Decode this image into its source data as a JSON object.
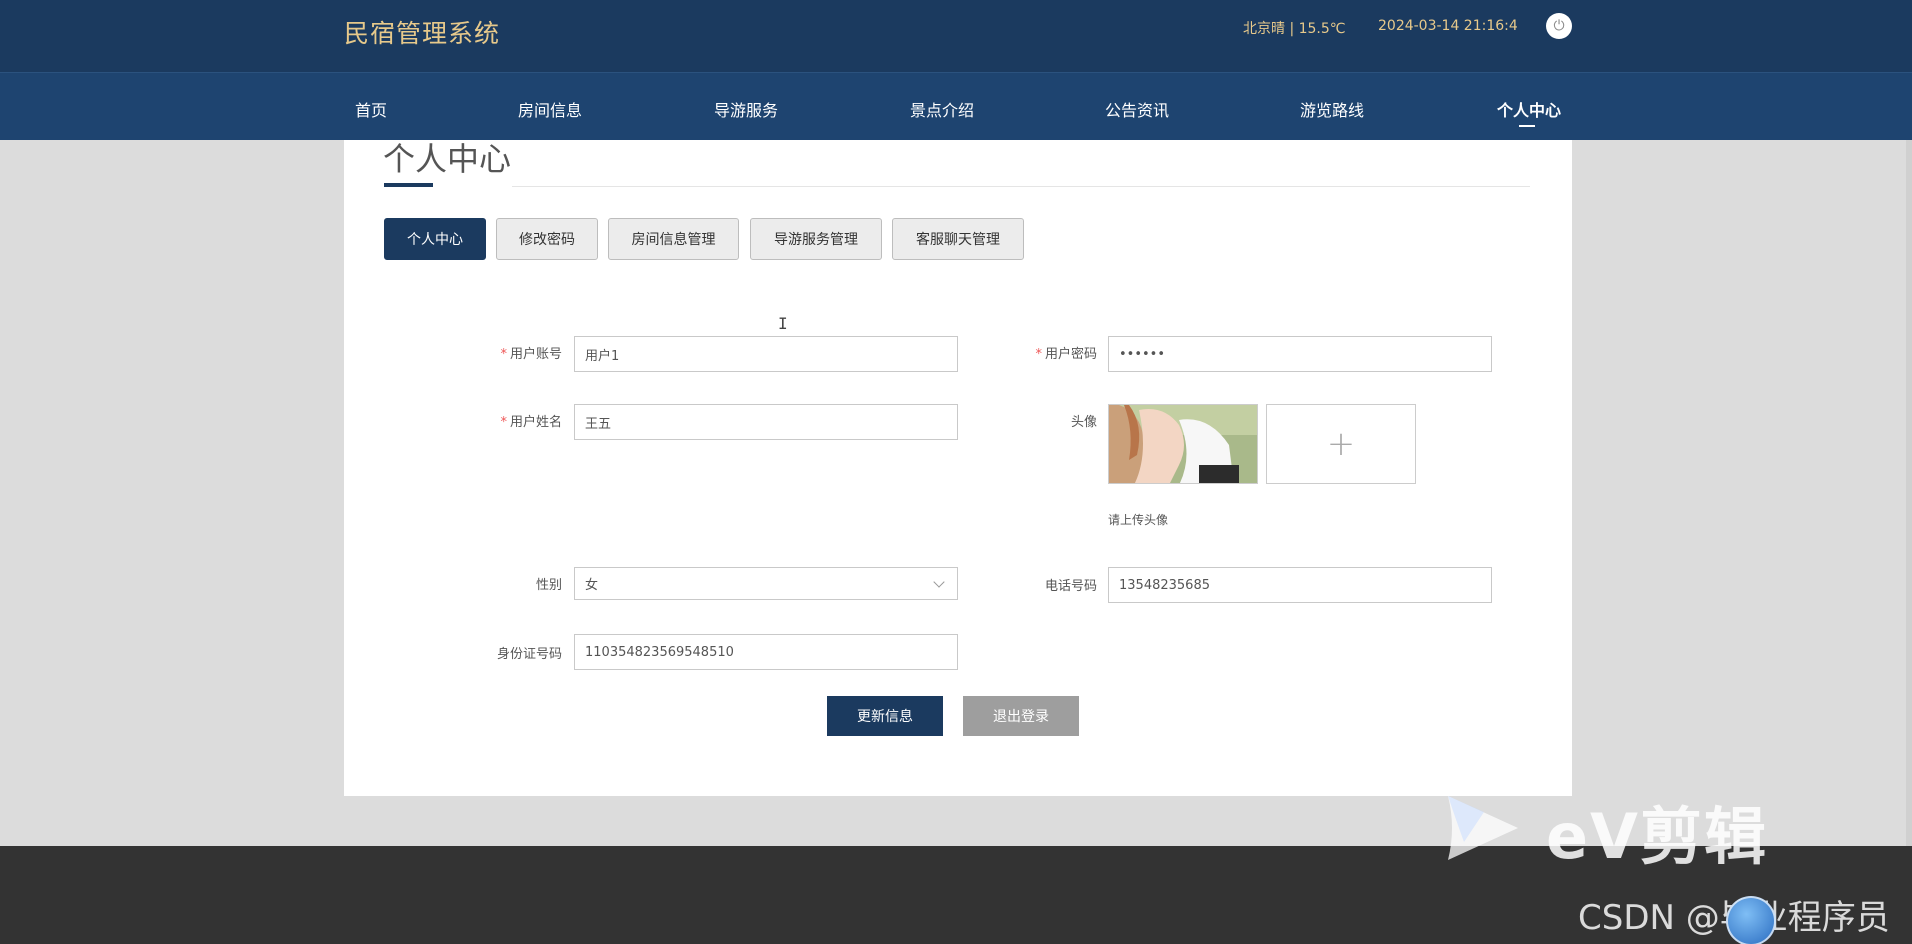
{
  "header": {
    "site_title": "民宿管理系统",
    "weather": "北京晴 | 15.5℃",
    "datetime": "2024-03-14   21:16:4",
    "power_icon": "power-icon"
  },
  "nav": {
    "items": [
      "首页",
      "房间信息",
      "导游服务",
      "景点介绍",
      "公告资讯",
      "游览路线",
      "个人中心"
    ],
    "active": "个人中心"
  },
  "page": {
    "title": "个人中心"
  },
  "tabs": [
    "个人中心",
    "修改密码",
    "房间信息管理",
    "导游服务管理",
    "客服聊天管理"
  ],
  "form": {
    "account_label": "用户账号",
    "account_value": "用户1",
    "password_label": "用户密码",
    "password_value": "••••••",
    "name_label": "用户姓名",
    "name_value": "王五",
    "avatar_label": "头像",
    "upload_icon": "plus-icon",
    "upload_hint": "请上传头像",
    "gender_label": "性别",
    "gender_value": "女",
    "phone_label": "电话号码",
    "phone_value": "13548235685",
    "idcard_label": "身份证号码",
    "idcard_value": "110354823569548510",
    "required_mark": "*"
  },
  "buttons": {
    "update": "更新信息",
    "logout": "退出登录"
  },
  "colors": {
    "header_bg": "#1b3a5f",
    "accent_gold": "#e7c98b",
    "primary": "#1b3a5f",
    "logout_bg": "#9e9e9e"
  },
  "watermark": {
    "editor": "eV剪辑",
    "csdn": "CSDN @毕业程序员"
  }
}
